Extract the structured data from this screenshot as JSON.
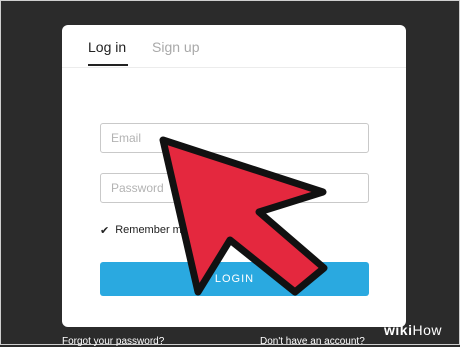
{
  "tabs": {
    "login": "Log in",
    "signup": "Sign up"
  },
  "form": {
    "email_placeholder": "Email",
    "password_placeholder": "Password",
    "remember_label": "Remember me at",
    "login_button": "LOGIN"
  },
  "footer": {
    "forgot": "Forgot your password?",
    "no_account": "Don't have an account?"
  },
  "watermark": {
    "wiki": "wiki",
    "how": "How"
  },
  "colors": {
    "background": "#2b2b2b",
    "card": "#ffffff",
    "button": "#2aa9e0",
    "arrow_fill": "#e4283e",
    "arrow_stroke": "#111111"
  },
  "icons": {
    "check": "checkmark-icon",
    "pointer": "cursor-arrow-icon"
  }
}
